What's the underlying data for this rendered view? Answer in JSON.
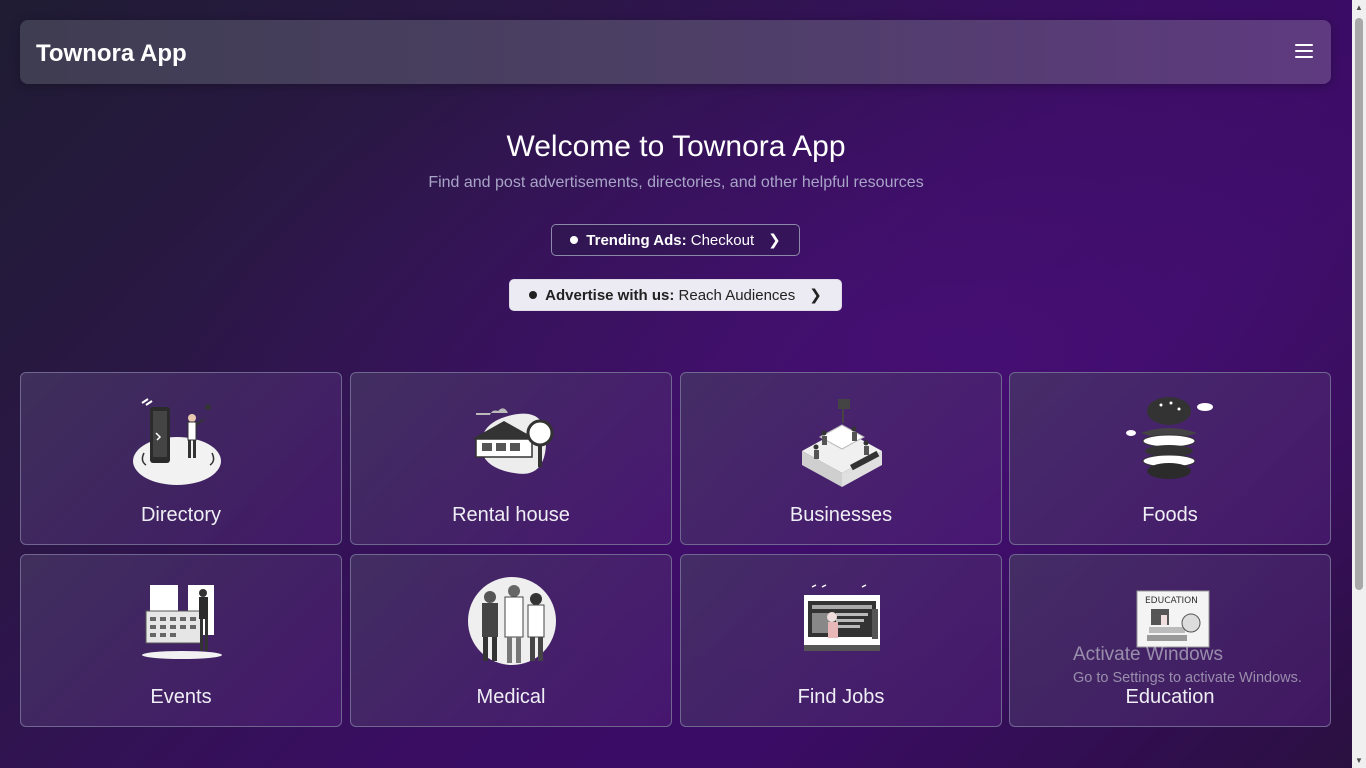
{
  "navbar": {
    "brand": "Townora App",
    "menu_icon": "hamburger-menu-icon"
  },
  "hero": {
    "title": "Welcome to Townora App",
    "subtitle": "Find and post advertisements, directories, and other helpful resources"
  },
  "pills": {
    "trending": {
      "bold": "Trending Ads:",
      "text": "Checkout"
    },
    "advertise": {
      "bold": "Advertise with us:",
      "text": "Reach Audiences"
    }
  },
  "categories": [
    {
      "label": "Directory",
      "icon": "phone-directory-illustration"
    },
    {
      "label": "Rental house",
      "icon": "house-search-illustration"
    },
    {
      "label": "Businesses",
      "icon": "office-building-illustration"
    },
    {
      "label": "Foods",
      "icon": "food-burger-illustration"
    },
    {
      "label": "Events",
      "icon": "calendar-event-illustration"
    },
    {
      "label": "Medical",
      "icon": "medical-staff-illustration"
    },
    {
      "label": "Find Jobs",
      "icon": "job-search-illustration"
    },
    {
      "label": "Education",
      "icon": "education-book-illustration"
    }
  ],
  "watermark": {
    "line1": "Activate Windows",
    "line2": "Go to Settings to activate Windows."
  },
  "colors": {
    "accent": "#3b0c66",
    "navbar": "#4d3f66",
    "card_border": "#6f6790"
  }
}
